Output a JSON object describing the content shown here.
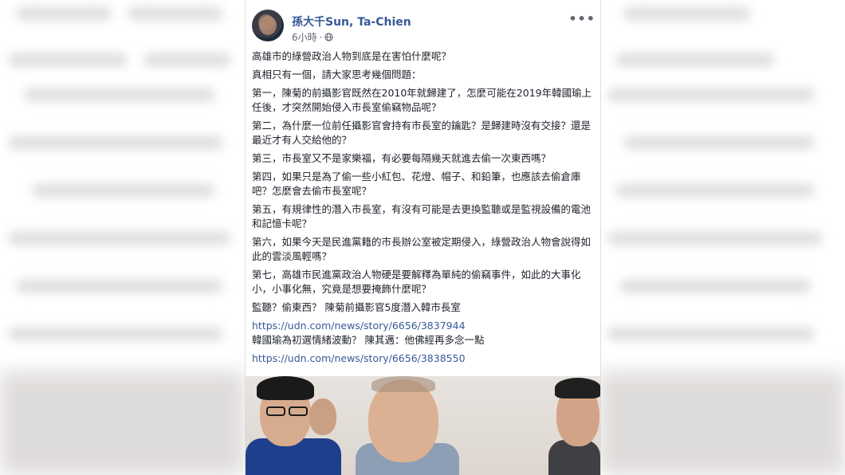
{
  "post": {
    "author": "孫大千Sun, Ta-Chien",
    "timestamp": "6小時",
    "separator": "·",
    "paragraphs": [
      "高雄市的綠營政治人物到底是在害怕什麼呢？",
      "真相只有一個，請大家思考幾個問題：",
      "第一，陳菊的前攝影官既然在2010年就歸建了，怎麼可能在2019年韓國瑜上任後，才突然開始侵入市長室偷竊物品呢？",
      "第二，為什麼一位前任攝影官會持有市長室的鑰匙？是歸建時沒有交接？還是最近才有人交給他的？",
      "第三，市長室又不是家樂福，有必要每隔幾天就進去偷一次東西嗎？",
      "第四，如果只是為了偷一些小紅包、花燈、帽子、和鉛筆，也應該去偷倉庫吧？怎麼會去偷市長室呢？",
      "第五，有規律性的潛入市長室，有沒有可能是去更換監聽或是監視設備的電池和記憶卡呢？",
      "第六，如果今天是民進黨籍的市長辦公室被定期侵入，綠營政治人物會說得如此的雲淡風輕嗎？",
      "第七，高雄市民進黨政治人物硬是要解釋為單純的偷竊事件，如此的大事化小，小事化無，究竟是想要掩飾什麼呢？"
    ],
    "links": [
      {
        "title": "監聽？偷東西？ 陳菊前攝影官5度潛入韓市長室",
        "url": "https://udn.com/news/story/6656/3837944"
      },
      {
        "title": "韓國瑜為初選情緒波動？ 陳其邁：他佛經再多念一點",
        "url": "https://udn.com/news/story/6656/3838550"
      }
    ]
  },
  "icons": {
    "more": "more-options-icon",
    "privacy": "globe-icon"
  },
  "colors": {
    "link": "#385898",
    "text": "#1d2129",
    "meta": "#616770"
  }
}
